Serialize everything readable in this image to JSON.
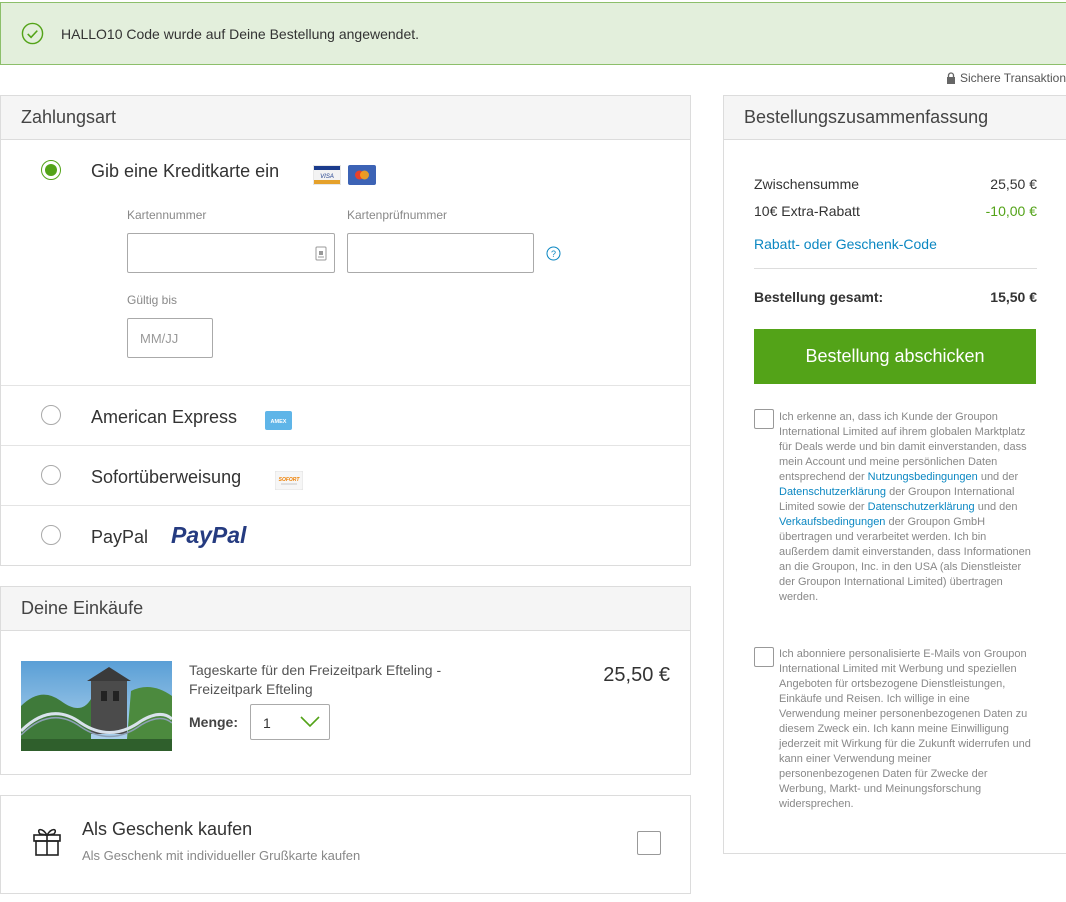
{
  "banner": {
    "message": "HALLO10 Code wurde auf Deine Bestellung angewendet."
  },
  "secure_label": "Sichere Transaktion",
  "payment": {
    "title": "Zahlungsart",
    "options": [
      {
        "label": "Gib eine Kreditkarte ein",
        "selected": true
      },
      {
        "label": "American Express",
        "selected": false
      },
      {
        "label": "Sofortüberweisung",
        "selected": false
      },
      {
        "label": "PayPal",
        "selected": false
      }
    ],
    "card_number_label": "Kartennummer",
    "cvc_label": "Kartenprüfnummer",
    "expiry_label": "Gültig bis",
    "expiry_placeholder": "MM/JJ",
    "card_badges": {
      "visa": "VISA",
      "amex": "AMEX",
      "sofort": "SOFORT",
      "paypal": "PayPal"
    }
  },
  "purchases": {
    "title": "Deine Einkäufe",
    "item_title": "Tageskarte für den Freizeitpark Efteling - Freizeitpark Efteling",
    "quantity_label": "Menge:",
    "quantity_value": "1",
    "price": "25,50 €"
  },
  "gift": {
    "title": "Als Geschenk kaufen",
    "subtitle": "Als Geschenk mit individueller Grußkarte kaufen"
  },
  "summary": {
    "title": "Bestellungszusammenfassung",
    "subtotal_label": "Zwischensumme",
    "subtotal_value": "25,50 €",
    "discount_label": "10€ Extra-Rabatt",
    "discount_value": "-10,00 €",
    "coupon_link": "Rabatt- oder Geschenk-Code",
    "total_label": "Bestellung gesamt:",
    "total_value": "15,50 €",
    "submit_label": "Bestellung abschicken",
    "consent_1": {
      "p1": "Ich erkenne an, dass ich Kunde der Groupon International Limited auf ihrem globalen Marktplatz für Deals werde und bin damit einverstanden, dass mein Account und meine persönlichen Daten entsprechend der ",
      "link1": "Nutzungsbedingungen",
      "p2": " und der ",
      "link2": "Datenschutzerklärung",
      "p3": " der Groupon International Limited sowie der ",
      "link3": "Datenschutzerklärung",
      "p4": " und den ",
      "link4": "Verkaufsbedingungen",
      "p5": " der Groupon GmbH übertragen und verarbeitet werden. Ich bin außerdem damit einverstanden, dass Informationen an die Groupon, Inc. in den USA (als Dienstleister der Groupon International Limited) übertragen werden."
    },
    "consent_2": "Ich abonniere personalisierte E-Mails von Groupon International Limited mit Werbung und speziellen Angeboten für ortsbezogene Dienstleistungen, Einkäufe und Reisen. Ich willige in eine Verwendung meiner personenbezogenen Daten zu diesem Zweck ein. Ich kann meine Einwilligung jederzeit mit Wirkung für die Zukunft widerrufen und kann einer Verwendung meiner personenbezogenen Daten für Zwecke der Werbung, Markt- und Meinungsforschung widersprechen."
  },
  "colors": {
    "accent_green": "#53a318",
    "link_blue": "#0b87c2",
    "discount_green": "#53a318"
  }
}
